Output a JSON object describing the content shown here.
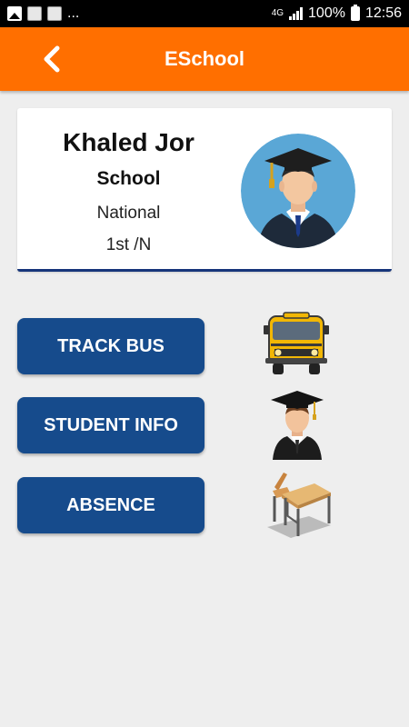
{
  "status_bar": {
    "network": "4G",
    "battery": "100%",
    "time": "12:56",
    "dots": "..."
  },
  "app_bar": {
    "title": "ESchool",
    "back_icon": "chevron-left-icon",
    "color": "#ff6f00"
  },
  "profile": {
    "name": "Khaled Jor",
    "school": "School",
    "type": "National",
    "grade": "1st /N",
    "avatar_icon": "graduate-avatar-icon"
  },
  "menu": [
    {
      "label": "TRACK BUS",
      "icon": "school-bus-icon"
    },
    {
      "label": "STUDENT INFO",
      "icon": "graduate-icon"
    },
    {
      "label": "ABSENCE",
      "icon": "school-desk-icon"
    }
  ],
  "colors": {
    "button": "#164b8c",
    "card_accent": "#16357a",
    "background": "#eeeeee"
  }
}
